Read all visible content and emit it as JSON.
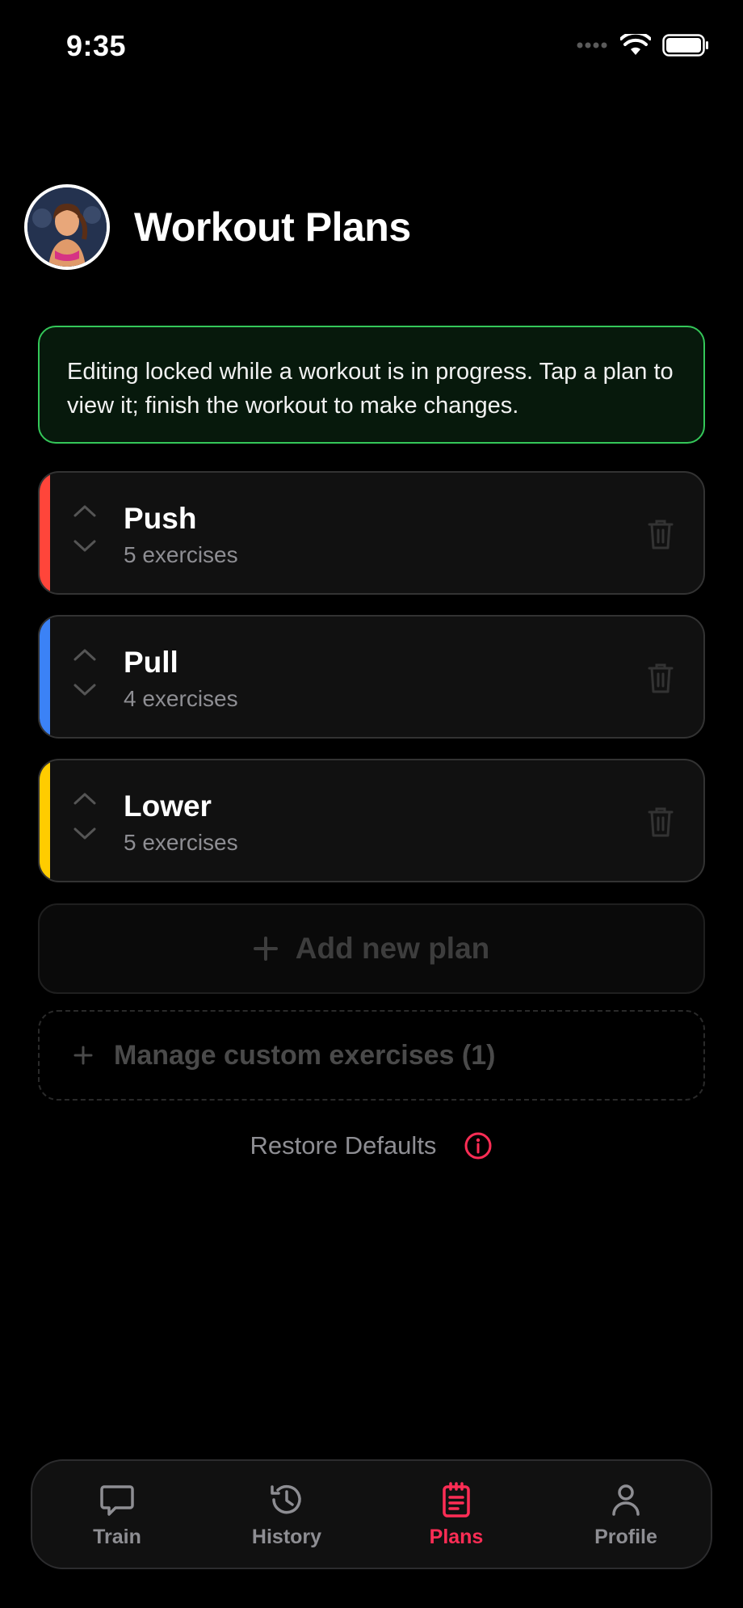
{
  "status_bar": {
    "time": "9:35"
  },
  "header": {
    "title": "Workout Plans"
  },
  "notice": {
    "text": "Editing locked while a workout is in progress. Tap a plan to view it; finish the workout to make changes."
  },
  "plans": [
    {
      "name": "Push",
      "count": "5 exercises",
      "color": "#ff453a"
    },
    {
      "name": "Pull",
      "count": "4 exercises",
      "color": "#3b82f6"
    },
    {
      "name": "Lower",
      "count": "5 exercises",
      "color": "#ffcc00"
    }
  ],
  "actions": {
    "add_plan": "Add new plan",
    "manage_custom": "Manage custom exercises (1)",
    "restore": "Restore Defaults"
  },
  "tabs": [
    {
      "label": "Train",
      "icon": "chat-bubble-icon"
    },
    {
      "label": "History",
      "icon": "history-icon"
    },
    {
      "label": "Plans",
      "icon": "clipboard-icon"
    },
    {
      "label": "Profile",
      "icon": "person-icon"
    }
  ],
  "colors": {
    "accent": "#ff2d55",
    "notice_border": "#34c759"
  }
}
